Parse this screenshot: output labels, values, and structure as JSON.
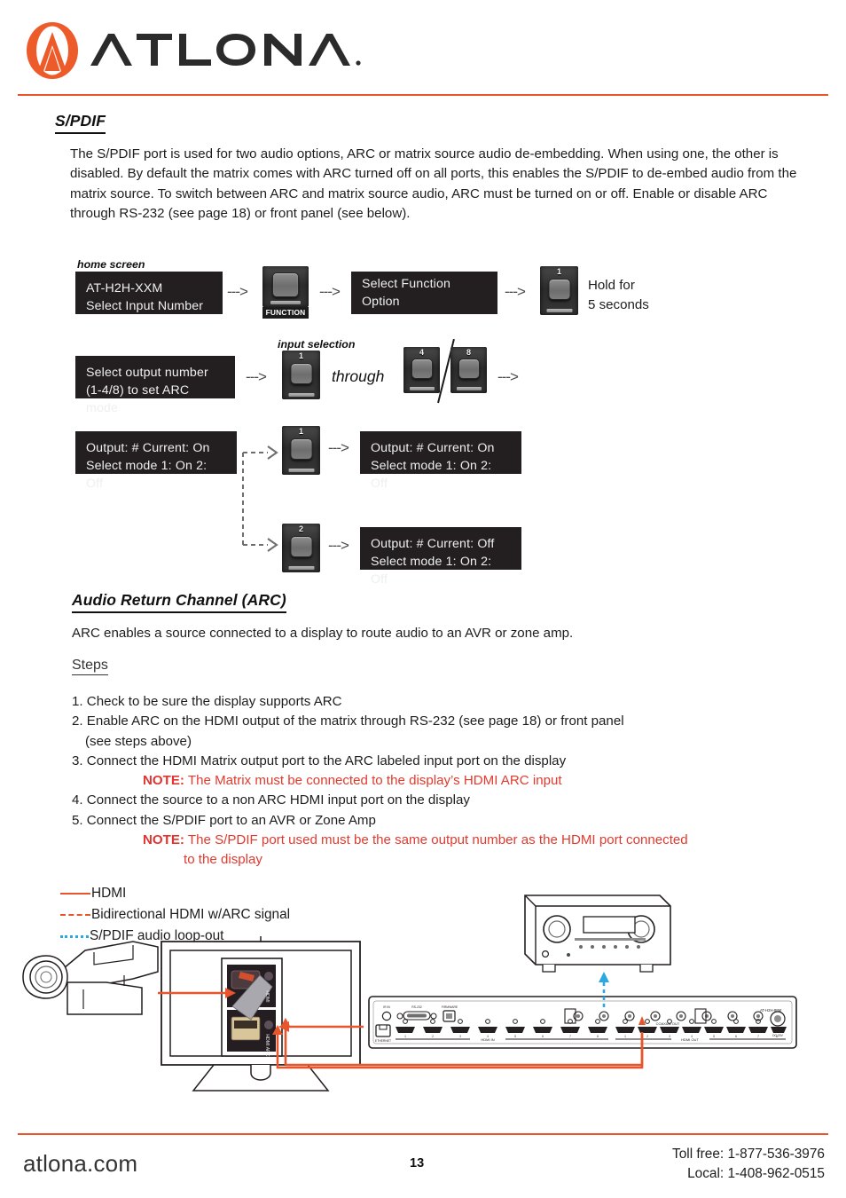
{
  "brand": {
    "logo_name": "atlona-logo",
    "wordmark": "ATLONA",
    "accent_color": "#E8542B",
    "note_color": "#E2342E",
    "spdif_color": "#29A9E0"
  },
  "sections": {
    "spdif": {
      "heading": "S/PDIF",
      "paragraph": "The S/PDIF port is used for two audio options, ARC or matrix source audio de-embedding. When using one, the other is disabled. By default the matrix comes with ARC turned off on all ports, this enables the S/PDIF to de-embed audio from the matrix source. To switch between ARC and matrix source audio, ARC must be turned on or off. Enable or disable ARC through RS-232 (see page 18) or front panel (see below)."
    },
    "arc": {
      "heading": "Audio Return Channel (ARC)",
      "paragraph": "ARC enables a source connected to a display to route audio to an AVR or zone amp.",
      "steps_heading": "Steps"
    }
  },
  "flow": {
    "caption_home": "home screen",
    "caption_input": "input selection",
    "through_label": "through",
    "arrow_glyph": "--->",
    "lcd_home": "AT-H2H-XXM\nSelect Input Number",
    "lcd_select_function": "Select Function Option",
    "lcd_select_output": "Select output number\n(1-4/8) to set ARC mode",
    "lcd_output_on": "Output: # Current: On\nSelect mode 1: On 2: Off",
    "lcd_output_on_2": "Output: # Current: On\nSelect mode 1: On 2: Off",
    "lcd_output_off": "Output: # Current: Off\nSelect mode 1: On 2: Off",
    "hold_text": "Hold for\n5 seconds",
    "function_button_label": "FUNCTION",
    "button_1": "1",
    "button_2": "2",
    "button_4": "4",
    "button_8": "8"
  },
  "steps_list": [
    {
      "num": "1.",
      "text": "Check to be sure the display supports ARC"
    },
    {
      "num": "2.",
      "text": "Enable ARC on the HDMI output of the matrix through RS-232 (see page 18) or front panel"
    },
    {
      "num": "",
      "text": "(see steps above)"
    },
    {
      "num": "3.",
      "text": "Connect the HDMI Matrix output port to the ARC labeled input port on the display"
    },
    {
      "num": "4.",
      "text": "Connect the source to a non ARC HDMI input port on the display"
    },
    {
      "num": "5.",
      "text": "Connect the S/PDIF port to an AVR or Zone Amp"
    }
  ],
  "notes": {
    "label": "NOTE:",
    "note1": "The Matrix must be connected to the display’s HDMI ARC input",
    "note2": "The S/PDIF port used must be the same output number as the HDMI port connected",
    "note2_cont": "to the display"
  },
  "legend": [
    {
      "style": "solid",
      "label": "HDMI"
    },
    {
      "style": "dashed",
      "label": "Bidirectional HDMI w/ARC signal"
    },
    {
      "style": "dotted",
      "label": "S/PDIF audio loop-out"
    }
  ],
  "illustration": {
    "tv_port_top": "HDMI",
    "tv_port_bottom": "HDMI\nARC",
    "matrix_model": "AT-H2H-88M",
    "matrix_labels": {
      "ir_in": "IR IN",
      "rs232": "RS-232",
      "firmware": "FIRMWARE",
      "ethernet": "ETHERNET",
      "hdmi_in": "HDMI IN",
      "hdmi_out": "HDMI OUT",
      "coaxial_out": "COAXIAL OUT",
      "dc": "DC 20V"
    },
    "port_numbers": [
      "1",
      "2",
      "3",
      "4",
      "5",
      "6",
      "7",
      "8"
    ]
  },
  "footer": {
    "site": "atlona.com",
    "page": "13",
    "toll_free": "Toll free: 1-877-536-3976",
    "local": "Local: 1-408-962-0515"
  }
}
